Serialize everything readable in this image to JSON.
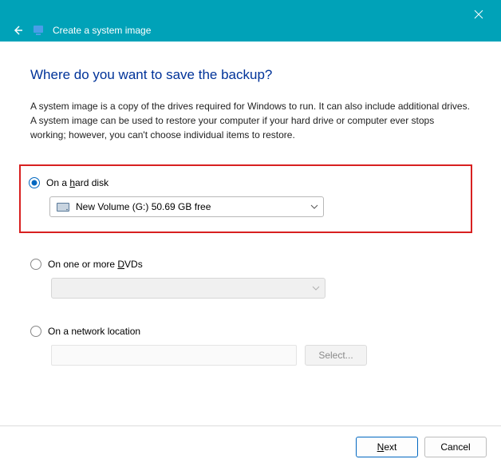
{
  "window": {
    "title": "Create a system image"
  },
  "page": {
    "heading": "Where do you want to save the backup?",
    "description": "A system image is a copy of the drives required for Windows to run. It can also include additional drives. A system image can be used to restore your computer if your hard drive or computer ever stops working; however, you can't choose individual items to restore."
  },
  "options": {
    "hard_disk": {
      "label_pre": "On a ",
      "label_accel": "h",
      "label_post": "ard disk",
      "selected_drive": "New Volume (G:)  50.69 GB free",
      "checked": true
    },
    "dvds": {
      "label_pre": "On one or more ",
      "label_accel": "D",
      "label_post": "VDs",
      "checked": false
    },
    "network": {
      "label": "On a network location",
      "checked": false,
      "select_button": "Select..."
    }
  },
  "footer": {
    "next_accel": "N",
    "next_post": "ext",
    "cancel": "Cancel"
  }
}
